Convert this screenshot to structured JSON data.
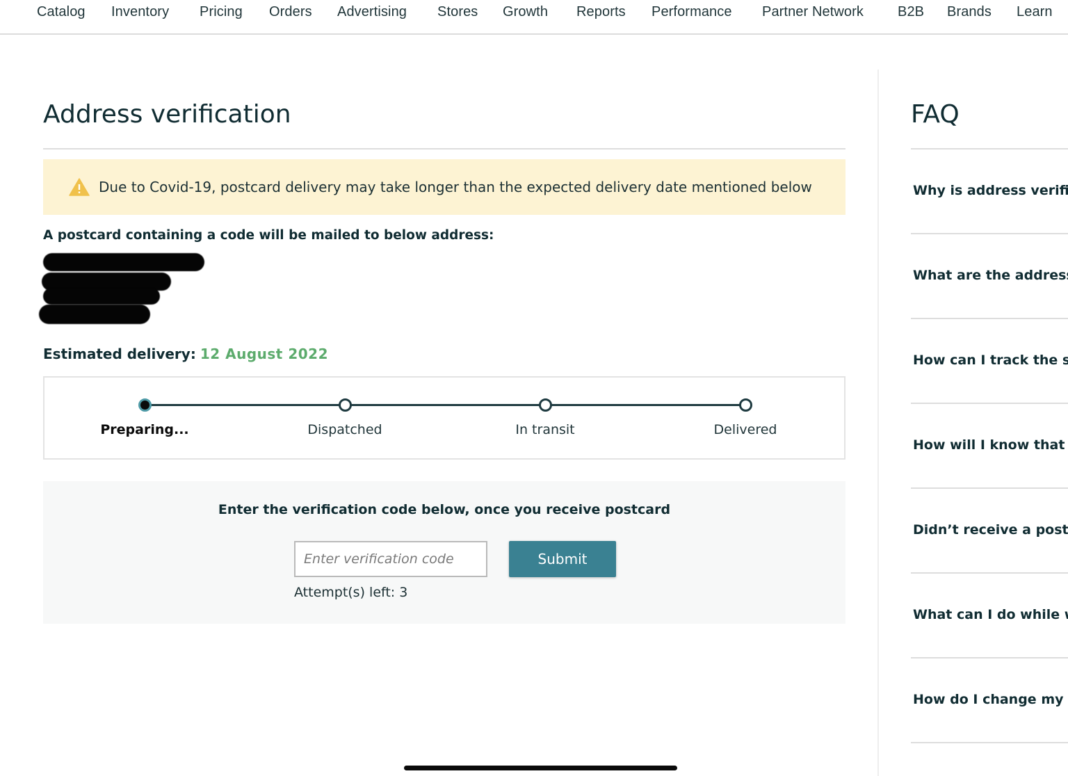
{
  "nav": {
    "items": [
      {
        "label": "Catalog"
      },
      {
        "label": "Inventory"
      },
      {
        "label": "Pricing"
      },
      {
        "label": "Orders"
      },
      {
        "label": "Advertising"
      },
      {
        "label": "Stores"
      },
      {
        "label": "Growth"
      },
      {
        "label": "Reports"
      },
      {
        "label": "Performance"
      },
      {
        "label": "Partner Network"
      },
      {
        "label": "B2B"
      },
      {
        "label": "Brands"
      },
      {
        "label": "Learn"
      }
    ]
  },
  "main": {
    "title": "Address verification",
    "alert": {
      "icon": "warning-triangle-icon",
      "text": "Due to Covid-19, postcard delivery may take longer than the expected delivery date mentioned below",
      "background": "#fdf3d3",
      "icon_color": "#f0c14b"
    },
    "mail_label": "A postcard containing a code will be mailed to below address:",
    "address_redacted": true,
    "delivery": {
      "label": "Estimated delivery:",
      "date": "12 August 2022",
      "date_color": "#5cab6c"
    },
    "tracker": {
      "current_step": 0,
      "steps": [
        {
          "label": "Preparing..."
        },
        {
          "label": "Dispatched"
        },
        {
          "label": "In transit"
        },
        {
          "label": "Delivered"
        }
      ]
    },
    "verification": {
      "prompt": "Enter the verification code below, once you receive postcard",
      "input_value": "",
      "input_placeholder": "Enter verification code",
      "submit_label": "Submit",
      "submit_color": "#3a8192",
      "attempts_text": "Attempt(s) left: 3"
    }
  },
  "faq": {
    "title": "FAQ",
    "items": [
      {
        "question": "Why is address verifica"
      },
      {
        "question": "What are the address d"
      },
      {
        "question": "How can I track the sta"
      },
      {
        "question": "How will I know that I"
      },
      {
        "question": "Didn’t receive a postca"
      },
      {
        "question": "What can I do while w"
      },
      {
        "question": "How do I change my a"
      }
    ]
  }
}
